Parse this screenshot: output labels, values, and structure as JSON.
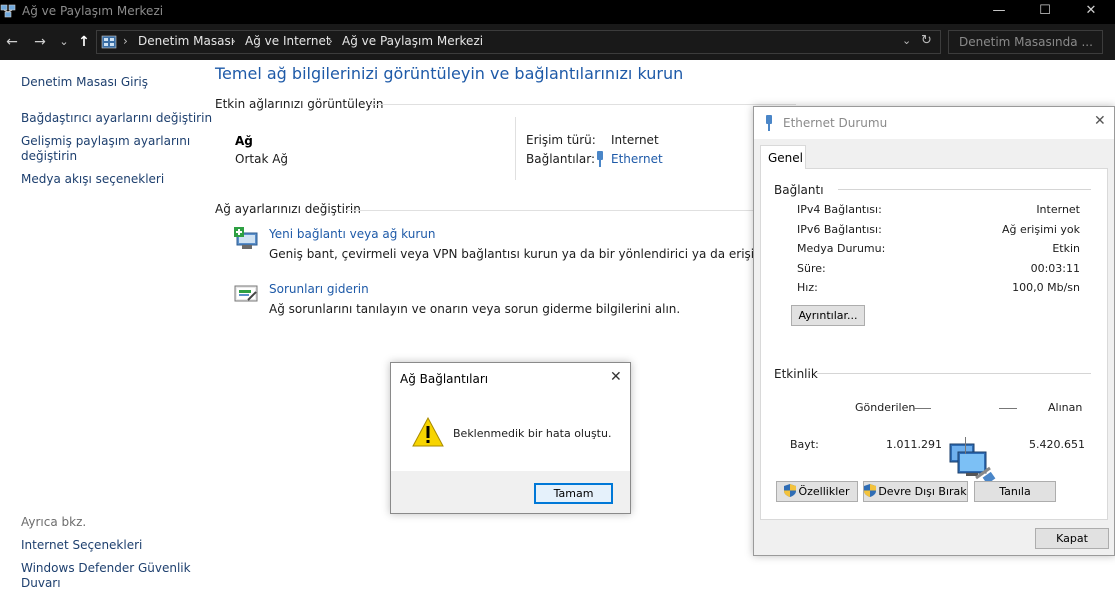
{
  "window": {
    "title": "Ağ ve Paylaşım Merkezi",
    "minimize_glyph": "—",
    "maximize_glyph": "☐",
    "close_glyph": "✕"
  },
  "nav": {
    "back": "←",
    "forward": "→",
    "recent": "⌄",
    "up": "↑"
  },
  "address": {
    "breadcrumb": [
      "Denetim Masası",
      "Ağ ve Internet",
      "Ağ ve Paylaşım Merkezi"
    ],
    "separator": "›",
    "dropdown_glyph": "⌄",
    "refresh_glyph": "↻"
  },
  "search": {
    "placeholder": "Denetim Masasında ..."
  },
  "sidebar": {
    "items": [
      {
        "label": "Denetim Masası Giriş"
      },
      {
        "label": "Bağdaştırıcı ayarlarını değiştirin"
      },
      {
        "label_line1": "Gelişmiş paylaşım ayarlarını",
        "label_line2": "değiştirin"
      },
      {
        "label": "Medya akışı seçenekleri"
      }
    ],
    "see_also": "Ayrıca bkz.",
    "see_also_items": [
      {
        "label": "Internet Seçenekleri"
      },
      {
        "label_line1": "Windows Defender Güvenlik",
        "label_line2": "Duvarı"
      }
    ]
  },
  "main": {
    "title": "Temel ağ bilgilerinizi görüntüleyin ve bağlantılarınızı kurun",
    "active_networks_heading": "Etkin ağlarınızı görüntüleyin",
    "network": {
      "name": "Ağ",
      "type": "Ortak Ağ",
      "access_type_label": "Erişim türü:",
      "access_type_value": "Internet",
      "connections_label": "Bağlantılar:",
      "connections_value": "Ethernet"
    },
    "change_settings_heading": "Ağ ayarlarınızı değiştirin",
    "tasks": [
      {
        "link": "Yeni bağlantı veya ağ kurun",
        "desc": "Geniş bant, çevirmeli veya VPN bağlantısı kurun ya da bir yönlendirici ya da erişim noktası ay",
        "icon": "new-connection-icon"
      },
      {
        "link": "Sorunları giderin",
        "desc": "Ağ sorunlarını tanılayın ve onarın veya sorun giderme bilgilerini alın.",
        "icon": "troubleshoot-icon"
      }
    ]
  },
  "ethernet_dialog": {
    "title": "Ethernet Durumu",
    "close_glyph": "✕",
    "tab": "Genel",
    "connection_group": "Bağlantı",
    "rows": [
      {
        "label": "IPv4 Bağlantısı:",
        "value": "Internet"
      },
      {
        "label": "IPv6 Bağlantısı:",
        "value": "Ağ erişimi yok"
      },
      {
        "label": "Medya Durumu:",
        "value": "Etkin"
      },
      {
        "label": "Süre:",
        "value": "00:03:11"
      },
      {
        "label": "Hız:",
        "value": "100,0 Mb/sn"
      }
    ],
    "details_button": "Ayrıntılar...",
    "activity_group": "Etkinlik",
    "sent_label": "Gönderilen",
    "received_label": "Alınan",
    "bytes_label": "Bayt:",
    "bytes_sent": "1.011.291",
    "bytes_received": "5.420.651",
    "properties_button": "Özellikler",
    "disable_button": "Devre Dışı Bırak",
    "diagnose_button": "Tanıla",
    "close_button": "Kapat"
  },
  "message_box": {
    "title": "Ağ Bağlantıları",
    "close_glyph": "✕",
    "message": "Beklenmedik bir hata oluştu.",
    "ok_button": "Tamam"
  },
  "colors": {
    "title_bar": "#000000",
    "address_bar": "#191919",
    "link_blue": "#1e5aa8",
    "dialog_bg": "#f0f0f0",
    "button_focus": "#0078d7",
    "warning_yellow": "#f7d400"
  }
}
